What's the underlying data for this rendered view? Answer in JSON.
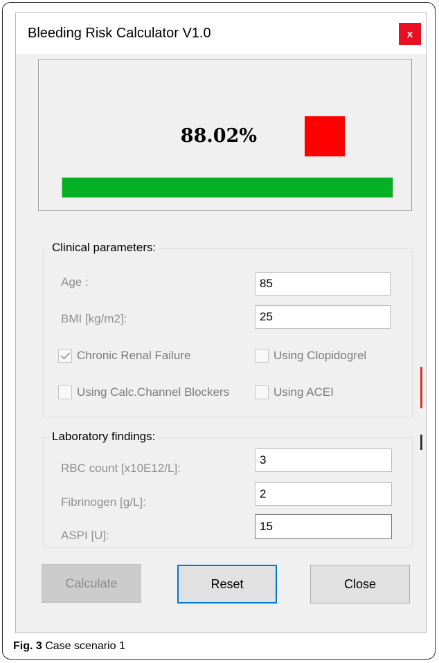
{
  "window": {
    "title": "Bleeding Risk Calculator V1.0",
    "close_glyph": "x"
  },
  "result": {
    "percentage": "88.02%",
    "indicator_color": "#ff0000",
    "progress_fraction": 1.0,
    "progress_color": "#06b025"
  },
  "clinical": {
    "legend": "Clinical parameters:",
    "age_label": "Age :",
    "age_value": "85",
    "bmi_label": "BMI [kg/m2]:",
    "bmi_value": "25",
    "checkboxes": [
      {
        "label": "Chronic Renal Failure",
        "checked": true
      },
      {
        "label": "Using Clopidogrel",
        "checked": false
      },
      {
        "label": "Using Calc.Channel Blockers",
        "checked": false
      },
      {
        "label": "Using ACEI",
        "checked": false
      }
    ]
  },
  "laboratory": {
    "legend": "Laboratory findings:",
    "rbc_label": "RBC count [x10E12/L]:",
    "rbc_value": "3",
    "fibrinogen_label": "Fibrinogen [g/L]:",
    "fibrinogen_value": "2",
    "aspi_label": "ASPI [U]:",
    "aspi_value": "15"
  },
  "buttons": {
    "calculate": "Calculate",
    "reset": "Reset",
    "close": "Close"
  },
  "caption": {
    "prefix": "Fig. 3",
    "text": " Case scenario 1"
  }
}
